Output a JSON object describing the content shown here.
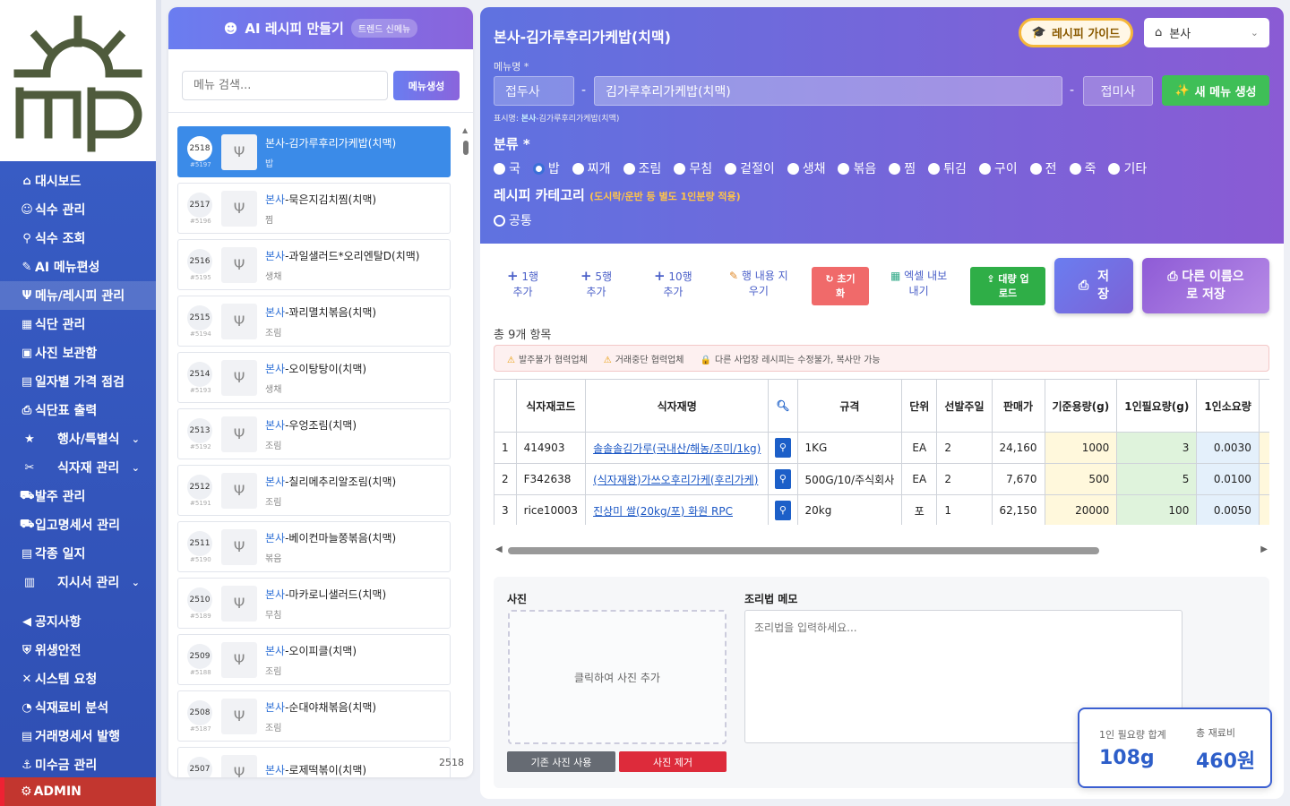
{
  "sidebar": {
    "items": [
      {
        "icon": "⌂",
        "label": "대시보드"
      },
      {
        "icon": "☺",
        "label": "식수 관리"
      },
      {
        "icon": "⚲",
        "label": "식수 조회"
      },
      {
        "icon": "✎",
        "label": "AI 메뉴편성"
      },
      {
        "icon": "Ψ",
        "label": "메뉴/레시피 관리",
        "active": true
      },
      {
        "icon": "▦",
        "label": "식단 관리"
      },
      {
        "icon": "▣",
        "label": "사진 보관함"
      },
      {
        "icon": "▤",
        "label": "일자별 가격 점검"
      },
      {
        "icon": "⎙",
        "label": "식단표 출력"
      },
      {
        "icon": "★",
        "label": "행사/특별식",
        "expand": true
      },
      {
        "icon": "✂",
        "label": "식자재 관리",
        "expand": true
      },
      {
        "icon": "⛟",
        "label": "발주 관리"
      },
      {
        "icon": "⛟",
        "label": "입고명세서 관리"
      },
      {
        "icon": "▤",
        "label": "각종 일지"
      },
      {
        "icon": "▥",
        "label": "지시서 관리",
        "expand": true
      }
    ],
    "items2": [
      {
        "icon": "◀",
        "label": "공지사항"
      },
      {
        "icon": "⛨",
        "label": "위생안전"
      },
      {
        "icon": "✕",
        "label": "시스템 요청"
      },
      {
        "icon": "◔",
        "label": "식재료비 분석"
      },
      {
        "icon": "▤",
        "label": "거래명세서 발행"
      },
      {
        "icon": "⚓",
        "label": "미수금 관리"
      }
    ],
    "admin_label": "ADMIN"
  },
  "recipe_panel": {
    "title": "AI 레시피 만들기",
    "badge": "트렌드 신메뉴",
    "search_placeholder": "메뉴 검색...",
    "create_button": "메뉴생성",
    "items": [
      {
        "num": "2518",
        "sub": "#5197",
        "brand": "본사",
        "name": "-김가루후리가케밥(치맥)",
        "cat": "밥",
        "selected": true
      },
      {
        "num": "2517",
        "sub": "#5196",
        "brand": "본사",
        "name": "-묵은지김치찜(치맥)",
        "cat": "찜"
      },
      {
        "num": "2516",
        "sub": "#5195",
        "brand": "본사",
        "name": "-과일샐러드*오리엔탈D(치맥)",
        "cat": "생채"
      },
      {
        "num": "2515",
        "sub": "#5194",
        "brand": "본사",
        "name": "-꽈리멸치볶음(치맥)",
        "cat": "조림"
      },
      {
        "num": "2514",
        "sub": "#5193",
        "brand": "본사",
        "name": "-오이탕탕이(치맥)",
        "cat": "생채"
      },
      {
        "num": "2513",
        "sub": "#5192",
        "brand": "본사",
        "name": "-우엉조림(치맥)",
        "cat": "조림"
      },
      {
        "num": "2512",
        "sub": "#5191",
        "brand": "본사",
        "name": "-칠리메추리알조림(치맥)",
        "cat": "조림"
      },
      {
        "num": "2511",
        "sub": "#5190",
        "brand": "본사",
        "name": "-베이컨마늘쫑볶음(치맥)",
        "cat": "볶음"
      },
      {
        "num": "2510",
        "sub": "#5189",
        "brand": "본사",
        "name": "-마카로니샐러드(치맥)",
        "cat": "무침"
      },
      {
        "num": "2509",
        "sub": "#5188",
        "brand": "본사",
        "name": "-오이피클(치맥)",
        "cat": "조림"
      },
      {
        "num": "2508",
        "sub": "#5187",
        "brand": "본사",
        "name": "-순대야채볶음(치맥)",
        "cat": "조림"
      },
      {
        "num": "2507",
        "sub": "",
        "brand": "본사",
        "name": "-로제떡볶이(치맥)",
        "cat": ""
      }
    ],
    "count": "2518"
  },
  "editor": {
    "title": "본사-김가루후리가케밥(치맥)",
    "guide_button": "레시피 가이드",
    "location": "본사",
    "menu_name_label": "메뉴명 *",
    "prefix_placeholder": "접두사",
    "menu_name_value": "김가루후리가케밥(치맥)",
    "suffix_placeholder": "접미사",
    "new_menu_button": "새 메뉴 생성",
    "display_label": "표시명: ",
    "display_brand": "본사",
    "display_name": "-김가루후리가케밥(치맥)",
    "category_label": "분류 *",
    "categories": [
      "국",
      "밥",
      "찌개",
      "조림",
      "무침",
      "겉절이",
      "생채",
      "볶음",
      "찜",
      "튀김",
      "구이",
      "전",
      "죽",
      "기타"
    ],
    "selected_category": "밥",
    "recipe_category_label": "레시피 카테고리",
    "recipe_category_note": "(도시락/운반 등 별도 1인분량 적용)",
    "recipe_category_option": "공통"
  },
  "toolbar": {
    "add1_a": "1행",
    "add1_b": "추가",
    "add5_a": "5행",
    "add5_b": "추가",
    "add10_a": "10행",
    "add10_b": "추가",
    "clear_a": "행 내용 지",
    "clear_b": "우기",
    "reset_a": "초기",
    "reset_b": "화",
    "excel_a": "엑셀 내보",
    "excel_b": "내기",
    "bulk_a": "대량 업",
    "bulk_b": "로드",
    "save_a": "저",
    "save_b": "장",
    "saveas_a": "다른 이름으",
    "saveas_b": "로 저장"
  },
  "total_label": "총 9개 항목",
  "warnings": [
    "발주불가 협력업체",
    "거래중단 협력업체",
    "다른 사업장 레시피는 수정불가, 복사만 가능"
  ],
  "table": {
    "headers": [
      "",
      "식자재코드",
      "식자재명",
      "search",
      "규격",
      "단위",
      "선발주일",
      "판매가",
      "기준용량(g)",
      "1인필요량(g)",
      "1인소요량"
    ],
    "rows": [
      [
        "1",
        "414903",
        "솔솔솔김가루(국내산/해농/조미/1kg)",
        "",
        "1KG",
        "EA",
        "2",
        "24,160",
        "1000",
        "3",
        "0.0030"
      ],
      [
        "2",
        "F342638",
        "(식자재왕)가쓰오후리가케(후리가케)",
        "",
        "500G/10/주식회사",
        "EA",
        "2",
        "7,670",
        "500",
        "5",
        "0.0100"
      ],
      [
        "3",
        "rice10003",
        "진상미 쌀(20kg/포) 화원 RPC",
        "",
        "20kg",
        "포",
        "1",
        "62,150",
        "20000",
        "100",
        "0.0050"
      ]
    ]
  },
  "bottom": {
    "photo_label": "사진",
    "photo_placeholder": "클릭하여 사진 추가",
    "use_old_photo": "기존 사진 사용",
    "remove_photo": "사진 제거",
    "memo_label": "조리법 메모",
    "memo_placeholder": "조리법을 입력하세요..."
  },
  "summary": {
    "need_label": "1인 필요량 합계",
    "need_value": "108g",
    "cost_label": "총 재료비",
    "cost_value": "460원"
  }
}
